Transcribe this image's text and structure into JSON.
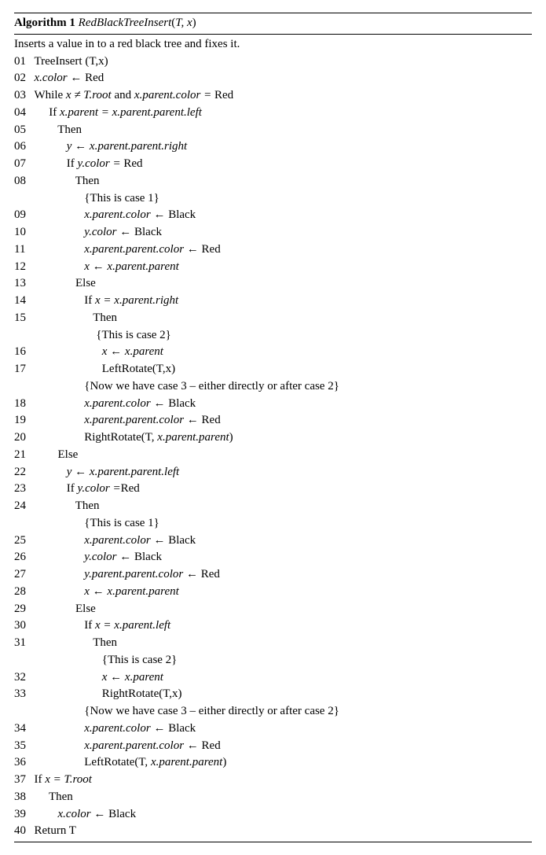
{
  "header": {
    "label": "Algorithm 1",
    "funcname": "RedBlackTreeInsert",
    "args_open": "(",
    "args": "T, x",
    "args_close": ")"
  },
  "description": "Inserts a value in to a red black tree and fixes it.",
  "lines": {
    "l01": {
      "n": "01",
      "text": "TreeInsert (T,x)"
    },
    "l02": {
      "n": "02",
      "a": "x.color",
      "arrow": " ← ",
      "b": "Red"
    },
    "l03": {
      "n": "03",
      "kw": "While ",
      "a": "x ≠ T.root",
      "andw": " and ",
      "b": "x.parent.color = ",
      "c": "Red"
    },
    "l04": {
      "n": "04",
      "kw": "If ",
      "expr": "x.parent = x.parent.parent.left"
    },
    "l05": {
      "n": "05",
      "kw": "Then"
    },
    "l06": {
      "n": "06",
      "a": "y ← x.parent.parent.right"
    },
    "l07": {
      "n": "07",
      "kw": "If ",
      "a": "y.color = ",
      "b": "Red"
    },
    "l08": {
      "n": "08",
      "kw": "Then"
    },
    "c08": {
      "text": "{This is case 1}"
    },
    "l09": {
      "n": "09",
      "a": "x.parent.color",
      "arrow": " ← ",
      "b": "Black"
    },
    "l10": {
      "n": "10",
      "a": "y.color",
      "arrow": " ← ",
      "b": "Black"
    },
    "l11": {
      "n": "11",
      "a": "x.parent.parent.color",
      "arrow": " ← ",
      "b": "Red"
    },
    "l12": {
      "n": "12",
      "a": "x ← x.parent.parent"
    },
    "l13": {
      "n": "13",
      "kw": "Else"
    },
    "l14": {
      "n": "14",
      "kw": "If ",
      "expr": "x = x.parent.right"
    },
    "l15": {
      "n": "15",
      "kw": "Then"
    },
    "c15": {
      "text": "{This is case 2}"
    },
    "l16": {
      "n": "16",
      "a": "x ← x.parent"
    },
    "l17": {
      "n": "17",
      "text": "LeftRotate(T,x)"
    },
    "c17": {
      "text": "{Now we have case 3 – either directly or after case 2}"
    },
    "l18": {
      "n": "18",
      "a": "x.parent.color",
      "arrow": " ← ",
      "b": "Black"
    },
    "l19": {
      "n": "19",
      "a": "x.parent.parent.color",
      "arrow": " ← ",
      "b": "Red"
    },
    "l20": {
      "n": "20",
      "text": "RightRotate(T, ",
      "arg": "x.parent.parent",
      "close": ")"
    },
    "l21": {
      "n": "21",
      "kw": "Else"
    },
    "l22": {
      "n": "22",
      "a": "y ← x.parent.parent.left"
    },
    "l23": {
      "n": "23",
      "kw": "If ",
      "a": "y.color =",
      "b": "Red"
    },
    "l24": {
      "n": "24",
      "kw": "Then"
    },
    "c24": {
      "text": "{This is case 1}"
    },
    "l25": {
      "n": "25",
      "a": "x.parent.color",
      "arrow": " ← ",
      "b": "Black"
    },
    "l26": {
      "n": "26",
      "a": "y.color",
      "arrow": " ← ",
      "b": "Black"
    },
    "l27": {
      "n": "27",
      "a": "y.parent.parent.color",
      "arrow": " ← ",
      "b": "Red"
    },
    "l28": {
      "n": "28",
      "a": "x ← x.parent.parent"
    },
    "l29": {
      "n": "29",
      "kw": "Else"
    },
    "l30": {
      "n": "30",
      "kw": "If ",
      "expr": "x = x.parent.left"
    },
    "l31": {
      "n": "31",
      "kw": "Then"
    },
    "c31": {
      "text": "{This is case 2}"
    },
    "l32": {
      "n": "32",
      "a": "x ← x.parent"
    },
    "l33": {
      "n": "33",
      "text": "RightRotate(T,x)"
    },
    "c33": {
      "text": "{Now we have case 3 – either directly or after case 2}"
    },
    "l34": {
      "n": "34",
      "a": "x.parent.color",
      "arrow": " ← ",
      "b": "Black"
    },
    "l35": {
      "n": "35",
      "a": "x.parent.parent.color",
      "arrow": " ← ",
      "b": "Red"
    },
    "l36": {
      "n": "36",
      "text": "LeftRotate(T, ",
      "arg": "x.parent.parent",
      "close": ")"
    },
    "l37": {
      "n": "37",
      "kw": "If ",
      "expr": "x = T.root"
    },
    "l38": {
      "n": "38",
      "kw": "Then"
    },
    "l39": {
      "n": "39",
      "a": "x.color",
      "arrow": " ← ",
      "b": "Black"
    },
    "l40": {
      "n": "40",
      "text": "Return T"
    }
  }
}
